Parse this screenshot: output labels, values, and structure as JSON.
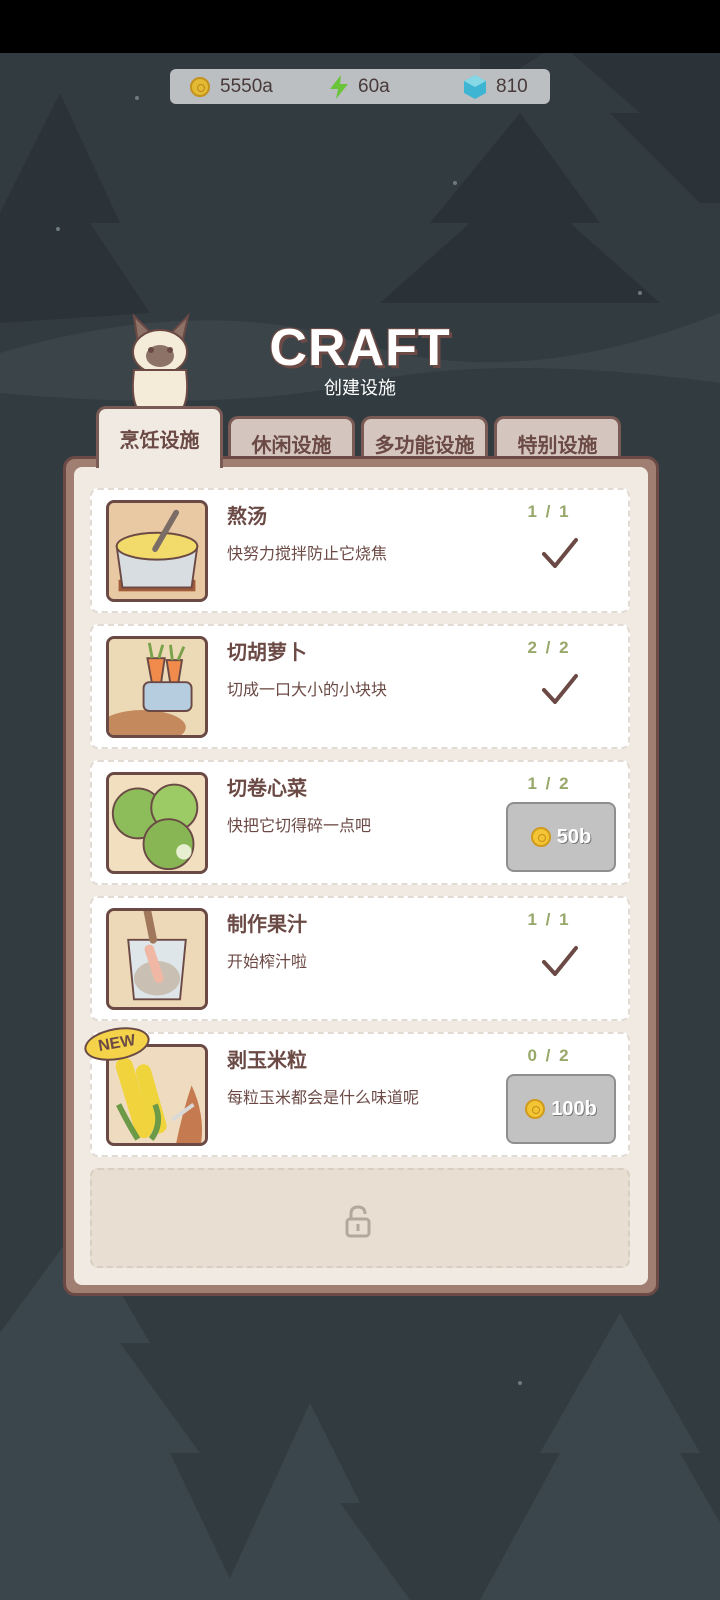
{
  "resources": {
    "coins": "5550a",
    "energy": "60a",
    "gems": "810",
    "coin_icon": "coin-icon",
    "energy_icon": "lightning-icon",
    "gem_icon": "gem-icon"
  },
  "header": {
    "title": "CRAFT",
    "subtitle": "创建设施"
  },
  "tabs": [
    {
      "label": "烹饪设施",
      "active": true
    },
    {
      "label": "休闲设施",
      "active": false
    },
    {
      "label": "多功能设施",
      "active": false
    },
    {
      "label": "特别设施",
      "active": false
    }
  ],
  "items": [
    {
      "name": "熬汤",
      "desc": "快努力搅拌防止它烧焦",
      "count": "1 / 1",
      "status": "done",
      "icon": "soup-pot-icon"
    },
    {
      "name": "切胡萝卜",
      "desc": "切成一口大小的小块块",
      "count": "2 / 2",
      "status": "done",
      "icon": "carrot-icon"
    },
    {
      "name": "切卷心菜",
      "desc": "快把它切得碎一点吧",
      "count": "1 / 2",
      "status": "buy",
      "price": "50b",
      "icon": "cabbage-icon"
    },
    {
      "name": "制作果汁",
      "desc": "开始榨汁啦",
      "count": "1 / 1",
      "status": "done",
      "icon": "juice-icon"
    },
    {
      "name": "剥玉米粒",
      "desc": "每粒玉米都会是什么味道呢",
      "count": "0 / 2",
      "status": "buy",
      "price": "100b",
      "badge": "NEW",
      "icon": "corn-icon"
    }
  ],
  "locked_slot": {
    "icon": "lock-icon"
  },
  "colors": {
    "background": "#323b40",
    "panel_border": "#6b4a45",
    "panel_fill": "#f1eae3",
    "count_green": "#98a86a",
    "button_gray": "#c2c2c2"
  }
}
